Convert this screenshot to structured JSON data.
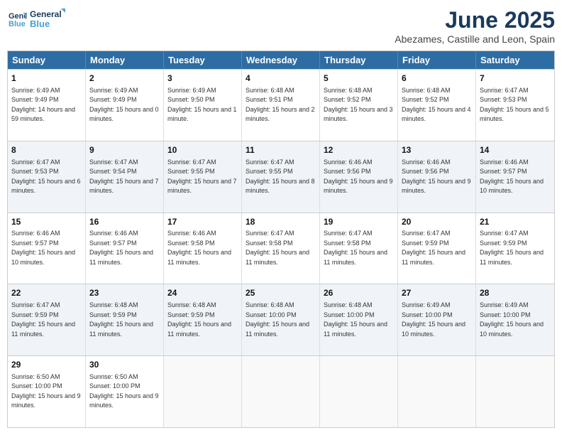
{
  "header": {
    "logo_line1": "General",
    "logo_line2": "Blue",
    "title": "June 2025",
    "subtitle": "Abezames, Castille and Leon, Spain"
  },
  "calendar": {
    "days_of_week": [
      "Sunday",
      "Monday",
      "Tuesday",
      "Wednesday",
      "Thursday",
      "Friday",
      "Saturday"
    ],
    "rows": [
      [
        {
          "day": "1",
          "sunrise": "Sunrise: 6:49 AM",
          "sunset": "Sunset: 9:49 PM",
          "daylight": "Daylight: 14 hours and 59 minutes."
        },
        {
          "day": "2",
          "sunrise": "Sunrise: 6:49 AM",
          "sunset": "Sunset: 9:49 PM",
          "daylight": "Daylight: 15 hours and 0 minutes."
        },
        {
          "day": "3",
          "sunrise": "Sunrise: 6:49 AM",
          "sunset": "Sunset: 9:50 PM",
          "daylight": "Daylight: 15 hours and 1 minute."
        },
        {
          "day": "4",
          "sunrise": "Sunrise: 6:48 AM",
          "sunset": "Sunset: 9:51 PM",
          "daylight": "Daylight: 15 hours and 2 minutes."
        },
        {
          "day": "5",
          "sunrise": "Sunrise: 6:48 AM",
          "sunset": "Sunset: 9:52 PM",
          "daylight": "Daylight: 15 hours and 3 minutes."
        },
        {
          "day": "6",
          "sunrise": "Sunrise: 6:48 AM",
          "sunset": "Sunset: 9:52 PM",
          "daylight": "Daylight: 15 hours and 4 minutes."
        },
        {
          "day": "7",
          "sunrise": "Sunrise: 6:47 AM",
          "sunset": "Sunset: 9:53 PM",
          "daylight": "Daylight: 15 hours and 5 minutes."
        }
      ],
      [
        {
          "day": "8",
          "sunrise": "Sunrise: 6:47 AM",
          "sunset": "Sunset: 9:53 PM",
          "daylight": "Daylight: 15 hours and 6 minutes."
        },
        {
          "day": "9",
          "sunrise": "Sunrise: 6:47 AM",
          "sunset": "Sunset: 9:54 PM",
          "daylight": "Daylight: 15 hours and 7 minutes."
        },
        {
          "day": "10",
          "sunrise": "Sunrise: 6:47 AM",
          "sunset": "Sunset: 9:55 PM",
          "daylight": "Daylight: 15 hours and 7 minutes."
        },
        {
          "day": "11",
          "sunrise": "Sunrise: 6:47 AM",
          "sunset": "Sunset: 9:55 PM",
          "daylight": "Daylight: 15 hours and 8 minutes."
        },
        {
          "day": "12",
          "sunrise": "Sunrise: 6:46 AM",
          "sunset": "Sunset: 9:56 PM",
          "daylight": "Daylight: 15 hours and 9 minutes."
        },
        {
          "day": "13",
          "sunrise": "Sunrise: 6:46 AM",
          "sunset": "Sunset: 9:56 PM",
          "daylight": "Daylight: 15 hours and 9 minutes."
        },
        {
          "day": "14",
          "sunrise": "Sunrise: 6:46 AM",
          "sunset": "Sunset: 9:57 PM",
          "daylight": "Daylight: 15 hours and 10 minutes."
        }
      ],
      [
        {
          "day": "15",
          "sunrise": "Sunrise: 6:46 AM",
          "sunset": "Sunset: 9:57 PM",
          "daylight": "Daylight: 15 hours and 10 minutes."
        },
        {
          "day": "16",
          "sunrise": "Sunrise: 6:46 AM",
          "sunset": "Sunset: 9:57 PM",
          "daylight": "Daylight: 15 hours and 11 minutes."
        },
        {
          "day": "17",
          "sunrise": "Sunrise: 6:46 AM",
          "sunset": "Sunset: 9:58 PM",
          "daylight": "Daylight: 15 hours and 11 minutes."
        },
        {
          "day": "18",
          "sunrise": "Sunrise: 6:47 AM",
          "sunset": "Sunset: 9:58 PM",
          "daylight": "Daylight: 15 hours and 11 minutes."
        },
        {
          "day": "19",
          "sunrise": "Sunrise: 6:47 AM",
          "sunset": "Sunset: 9:58 PM",
          "daylight": "Daylight: 15 hours and 11 minutes."
        },
        {
          "day": "20",
          "sunrise": "Sunrise: 6:47 AM",
          "sunset": "Sunset: 9:59 PM",
          "daylight": "Daylight: 15 hours and 11 minutes."
        },
        {
          "day": "21",
          "sunrise": "Sunrise: 6:47 AM",
          "sunset": "Sunset: 9:59 PM",
          "daylight": "Daylight: 15 hours and 11 minutes."
        }
      ],
      [
        {
          "day": "22",
          "sunrise": "Sunrise: 6:47 AM",
          "sunset": "Sunset: 9:59 PM",
          "daylight": "Daylight: 15 hours and 11 minutes."
        },
        {
          "day": "23",
          "sunrise": "Sunrise: 6:48 AM",
          "sunset": "Sunset: 9:59 PM",
          "daylight": "Daylight: 15 hours and 11 minutes."
        },
        {
          "day": "24",
          "sunrise": "Sunrise: 6:48 AM",
          "sunset": "Sunset: 9:59 PM",
          "daylight": "Daylight: 15 hours and 11 minutes."
        },
        {
          "day": "25",
          "sunrise": "Sunrise: 6:48 AM",
          "sunset": "Sunset: 10:00 PM",
          "daylight": "Daylight: 15 hours and 11 minutes."
        },
        {
          "day": "26",
          "sunrise": "Sunrise: 6:48 AM",
          "sunset": "Sunset: 10:00 PM",
          "daylight": "Daylight: 15 hours and 11 minutes."
        },
        {
          "day": "27",
          "sunrise": "Sunrise: 6:49 AM",
          "sunset": "Sunset: 10:00 PM",
          "daylight": "Daylight: 15 hours and 10 minutes."
        },
        {
          "day": "28",
          "sunrise": "Sunrise: 6:49 AM",
          "sunset": "Sunset: 10:00 PM",
          "daylight": "Daylight: 15 hours and 10 minutes."
        }
      ],
      [
        {
          "day": "29",
          "sunrise": "Sunrise: 6:50 AM",
          "sunset": "Sunset: 10:00 PM",
          "daylight": "Daylight: 15 hours and 9 minutes."
        },
        {
          "day": "30",
          "sunrise": "Sunrise: 6:50 AM",
          "sunset": "Sunset: 10:00 PM",
          "daylight": "Daylight: 15 hours and 9 minutes."
        },
        {
          "day": "",
          "sunrise": "",
          "sunset": "",
          "daylight": ""
        },
        {
          "day": "",
          "sunrise": "",
          "sunset": "",
          "daylight": ""
        },
        {
          "day": "",
          "sunrise": "",
          "sunset": "",
          "daylight": ""
        },
        {
          "day": "",
          "sunrise": "",
          "sunset": "",
          "daylight": ""
        },
        {
          "day": "",
          "sunrise": "",
          "sunset": "",
          "daylight": ""
        }
      ]
    ]
  }
}
